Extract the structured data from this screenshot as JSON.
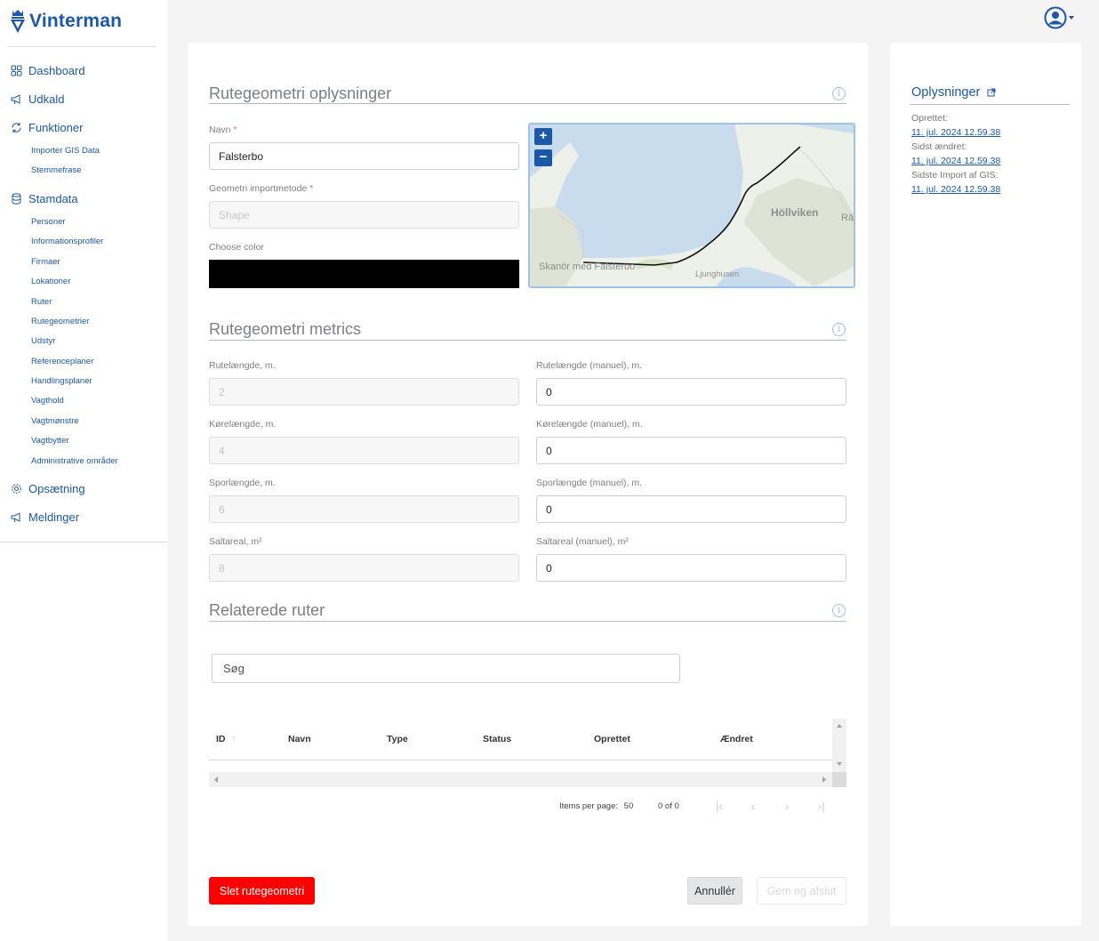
{
  "app": {
    "name": "Vinterman"
  },
  "nav": {
    "dashboard": "Dashboard",
    "udkald": "Udkald",
    "funktioner": "Funktioner",
    "funktioner_items": [
      "Importer GIS Data",
      "Stemmefrase"
    ],
    "stamdata": "Stamdata",
    "stamdata_items": [
      "Personer",
      "Informationsprofiler",
      "Firmaer",
      "Lokationer",
      "Ruter",
      "Rutegeometrier",
      "Udstyr",
      "Referenceplaner",
      "Handlingsplaner",
      "Vagthold",
      "Vagtmønstre",
      "Vagtbytter",
      "Administrative områder"
    ],
    "opsaetning": "Opsætning",
    "meddelelser": "Meldinger"
  },
  "sections": {
    "info_title": "Rutegeometri oplysninger",
    "metrics_title": "Rutegeometri metrics",
    "related_title": "Relaterede ruter"
  },
  "form": {
    "name_label": "Navn",
    "name_value": "Falsterbo",
    "method_label": "Geometri importmetode",
    "method_value": "Shape",
    "color_label": "Choose color",
    "color_value": "#000000",
    "required_mark": "*"
  },
  "map": {
    "zoom_in": "+",
    "zoom_out": "−",
    "labels": {
      "hollviken": "Höllviken",
      "skanor": "Skanör med Falsterbo",
      "ljunghusen": "Ljunghusen",
      "ra": "Rä"
    }
  },
  "metrics": {
    "rutelaengde_label": "Rutelængde, m.",
    "rutelaengde_value": "2",
    "rutelaengde_manuel_label": "Rutelængde (manuel), m.",
    "rutelaengde_manuel_value": "0",
    "koerelaengde_label": "Kørelængde, m.",
    "koerelaengde_value": "4",
    "koerelaengde_manuel_label": "Kørelængde (manuel), m.",
    "koerelaengde_manuel_value": "0",
    "sporlaengde_label": "Sporlængde, m.",
    "sporlaengde_value": "6",
    "sporlaengde_manuel_label": "Sporlængde (manuel), m.",
    "sporlaengde_manuel_value": "0",
    "saltareal_label": "Saltareal, m²",
    "saltareal_value": "8",
    "saltareal_manuel_label": "Saltareal (manuel), m²",
    "saltareal_manuel_value": "0"
  },
  "related": {
    "search_placeholder": "Søg",
    "columns": [
      "ID",
      "Navn",
      "Type",
      "Status",
      "Oprettet",
      "Ændret"
    ],
    "sort_indicator": "↑",
    "items_per_page_label": "Items per page:",
    "items_per_page_value": "50",
    "range": "0 of 0"
  },
  "actions": {
    "delete": "Slet rutegeometri",
    "cancel": "Annullér",
    "save": "Gem og afslut"
  },
  "info_panel": {
    "title": "Oplysninger",
    "created_label": "Oprettet:",
    "created_value": "11. jul. 2024 12.59.38",
    "changed_label": "Sidst ændret:",
    "changed_value": "11. jul. 2024 12.59.38",
    "import_label": "Sidste Import af GIS:",
    "import_value": "11. jul. 2024 12.59.38"
  },
  "colors": {
    "brand": "#1c58a8",
    "danger": "#ff0000",
    "water": "#c8dced",
    "route": "#111111"
  },
  "icons": [
    "dashboard-icon",
    "megaphone-icon",
    "refresh-icon",
    "database-icon",
    "gear-icon",
    "user-circle-icon",
    "info-icon",
    "external-link-icon"
  ]
}
